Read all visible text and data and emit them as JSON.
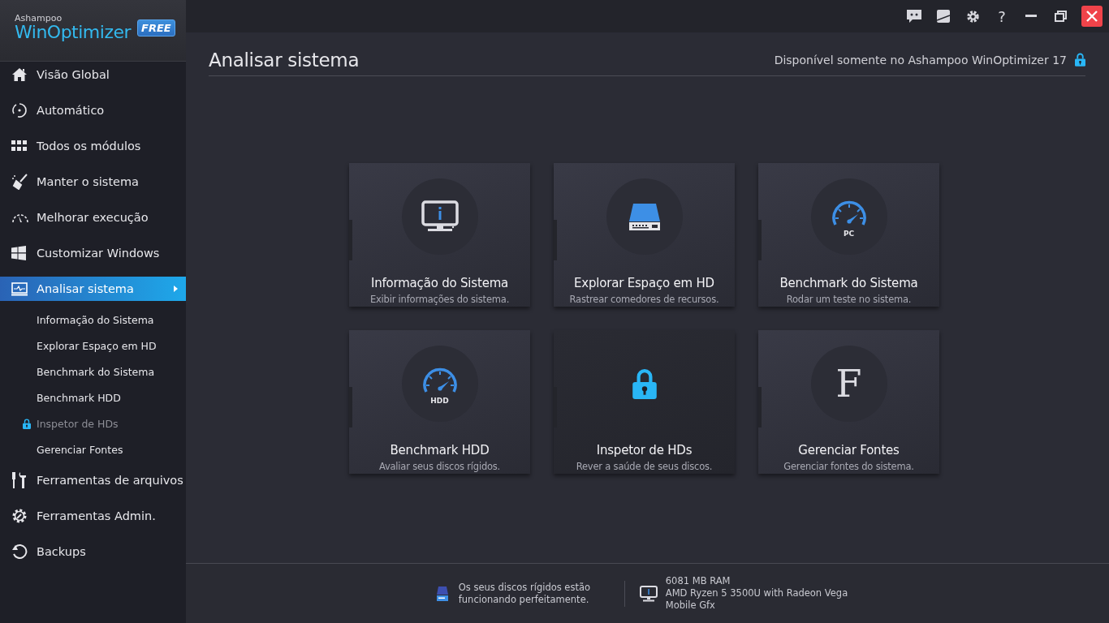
{
  "logo": {
    "brand": "Ashampoo",
    "product": "WinOptimizer",
    "edition": "FREE"
  },
  "title_bar": {
    "buttons": [
      {
        "kind": "feedback"
      },
      {
        "kind": "skin"
      },
      {
        "kind": "settings"
      },
      {
        "kind": "help",
        "label": "?"
      },
      {
        "kind": "minimize"
      },
      {
        "kind": "restore"
      },
      {
        "kind": "close"
      }
    ]
  },
  "sidebar": {
    "items": [
      {
        "label": "Visão Global",
        "selected": false
      },
      {
        "label": "Automático",
        "selected": false
      },
      {
        "label": "Todos os módulos",
        "selected": false
      },
      {
        "label": "Manter o sistema",
        "selected": false
      },
      {
        "label": "Melhorar execução",
        "selected": false
      },
      {
        "label": "Customizar Windows",
        "selected": false
      },
      {
        "label": "Analisar sistema",
        "selected": true,
        "expanded": true,
        "children": [
          {
            "label": "Informação do Sistema",
            "locked": false
          },
          {
            "label": "Explorar Espaço em HD",
            "locked": false
          },
          {
            "label": "Benchmark do Sistema",
            "locked": false
          },
          {
            "label": "Benchmark HDD",
            "locked": false
          },
          {
            "label": "Inspetor de HDs",
            "locked": true
          },
          {
            "label": "Gerenciar Fontes",
            "locked": false
          }
        ]
      },
      {
        "label": "Ferramentas de arquivos",
        "selected": false
      },
      {
        "label": "Ferramentas Admin.",
        "selected": false
      },
      {
        "label": "Backups",
        "selected": false
      }
    ]
  },
  "page": {
    "title": "Analisar sistema",
    "notice": "Disponível somente no Ashampoo WinOptimizer 17",
    "notice_locked": true
  },
  "modules": [
    {
      "title": "Informação do Sistema",
      "description": "Exibir informações do sistema.",
      "kind": "monitor",
      "locked": false
    },
    {
      "title": "Explorar Espaço em HD",
      "description": "Rastrear comedores de recursos.",
      "kind": "drive",
      "locked": false
    },
    {
      "title": "Benchmark do Sistema",
      "description": "Rodar um teste no sistema.",
      "kind": "gauge",
      "icon_text": "PC",
      "locked": false
    },
    {
      "title": "Benchmark HDD",
      "description": "Avaliar seus discos rígidos.",
      "kind": "gauge",
      "icon_text": "HDD",
      "locked": false
    },
    {
      "title": "Inspetor de HDs",
      "description": "Rever a saúde de seus discos.",
      "kind": "lock",
      "locked": true
    },
    {
      "title": "Gerenciar Fontes",
      "description": "Gerenciar fontes do sistema.",
      "kind": "font",
      "icon_text": "F",
      "locked": false
    }
  ],
  "status_bar": {
    "disk_status": "Os seus discos rígidos estão funcionando perfeitamente.",
    "system_info": [
      "6081 MB RAM",
      "AMD Ryzen 5 3500U with Radeon Vega",
      "Mobile Gfx"
    ]
  }
}
